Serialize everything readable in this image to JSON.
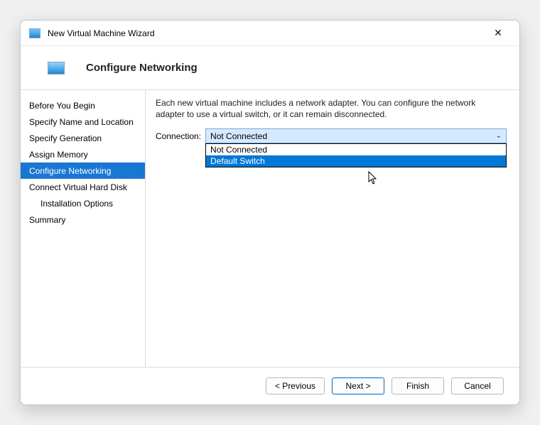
{
  "window": {
    "title": "New Virtual Machine Wizard"
  },
  "header": {
    "title": "Configure Networking"
  },
  "sidebar": {
    "items": [
      {
        "label": "Before You Begin",
        "selected": false,
        "indent": false
      },
      {
        "label": "Specify Name and Location",
        "selected": false,
        "indent": false
      },
      {
        "label": "Specify Generation",
        "selected": false,
        "indent": false
      },
      {
        "label": "Assign Memory",
        "selected": false,
        "indent": false
      },
      {
        "label": "Configure Networking",
        "selected": true,
        "indent": false
      },
      {
        "label": "Connect Virtual Hard Disk",
        "selected": false,
        "indent": false
      },
      {
        "label": "Installation Options",
        "selected": false,
        "indent": true
      },
      {
        "label": "Summary",
        "selected": false,
        "indent": false
      }
    ]
  },
  "content": {
    "description": "Each new virtual machine includes a network adapter. You can configure the network adapter to use a virtual switch, or it can remain disconnected.",
    "connection_label": "Connection:",
    "connection_value": "Not Connected",
    "options": [
      {
        "label": "Not Connected",
        "focused": false
      },
      {
        "label": "Default Switch",
        "focused": true
      }
    ]
  },
  "footer": {
    "previous": "< Previous",
    "next": "Next >",
    "finish": "Finish",
    "cancel": "Cancel"
  }
}
